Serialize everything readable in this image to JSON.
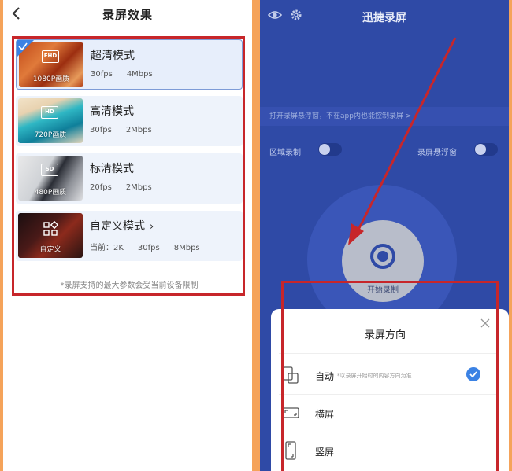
{
  "left": {
    "header": {
      "title": "录屏效果"
    },
    "options": [
      {
        "thumb_badge": "FHD",
        "thumb_label": "1080P画质",
        "title": "超清模式",
        "fps": "30fps",
        "bitrate": "4Mbps",
        "selected": true
      },
      {
        "thumb_badge": "HD",
        "thumb_label": "720P画质",
        "title": "高清模式",
        "fps": "30fps",
        "bitrate": "2Mbps",
        "selected": false
      },
      {
        "thumb_badge": "SD",
        "thumb_label": "480P画质",
        "title": "标清模式",
        "fps": "20fps",
        "bitrate": "2Mbps",
        "selected": false
      },
      {
        "thumb_label": "自定义",
        "title": "自定义模式",
        "current_prefix": "当前：2K",
        "fps": "30fps",
        "bitrate": "8Mbps",
        "selected": false
      }
    ],
    "footnote": "*录屏支持的最大参数会受当前设备限制"
  },
  "right": {
    "header": {
      "title": "迅捷录屏"
    },
    "float_tip": "打开录屏悬浮窗，不在app内也能控制录屏 >",
    "toggles": {
      "region_label": "区域录制",
      "float_label": "录屏悬浮窗"
    },
    "record_label": "开始录制",
    "sheet": {
      "title": "录屏方向",
      "options": [
        {
          "label": "自动",
          "hint": "*以录屏开始时的内容方向为准",
          "selected": true
        },
        {
          "label": "横屏"
        },
        {
          "label": "竖屏"
        }
      ]
    }
  },
  "colors": {
    "accent_red": "#c7262a",
    "check_blue": "#3b82e4",
    "panel_blue": "#2f4aa6"
  }
}
